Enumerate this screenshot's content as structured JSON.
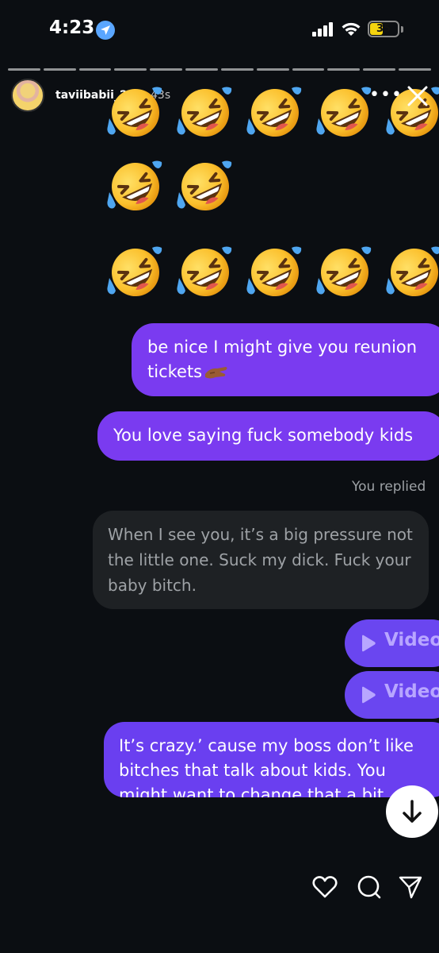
{
  "status_bar": {
    "time": "4:23",
    "battery": "35",
    "icons": [
      "location-arrow-icon",
      "signal-bars-icon",
      "wifi-icon",
      "battery-icon"
    ]
  },
  "story": {
    "username": "taviibabii_27",
    "age": "43s",
    "segment_count": 12
  },
  "emoji_rows": [
    {
      "count": 5,
      "emoji": "rolling-on-floor-laughing"
    },
    {
      "count": 2,
      "emoji": "rolling-on-floor-laughing"
    },
    {
      "count": 5,
      "emoji": "rolling-on-floor-laughing"
    }
  ],
  "messages": {
    "m1_line1": "be nice I might give you reunion",
    "m1_line2": "tickets",
    "m2": "You love saying fuck somebody kids",
    "replied_label": "You replied",
    "quote_line1": "When I see you, it’s a big pressure not",
    "quote_line2": "the little one. Suck my dick. Fuck your",
    "quote_line3": "baby bitch.",
    "video_label": "Video",
    "m3_line1": "It’s crazy.’ cause my boss don’t like",
    "m3_line2": "bitches that talk about kids. You",
    "m3_line3": "might want to change that a bit"
  },
  "colors": {
    "background": "#0b0e12",
    "sent_bubble": "#7a3bf0",
    "sent_bubble_alt": "#6a3ff0",
    "quote_bubble": "#1e2124",
    "video_bubble": "#6a46f0"
  },
  "actions": [
    "heart-icon",
    "comment-icon",
    "share-icon"
  ]
}
